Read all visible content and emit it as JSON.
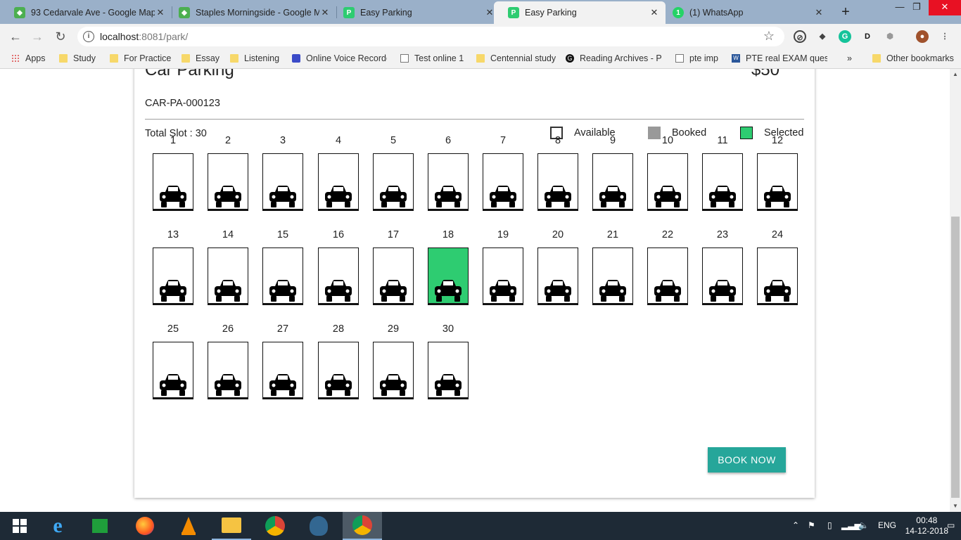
{
  "browser": {
    "tabs": [
      {
        "title": "93 Cedarvale Ave - Google Map",
        "icon": "google-maps-icon",
        "active": false
      },
      {
        "title": "Staples Morningside - Google M",
        "icon": "google-maps-icon",
        "active": false
      },
      {
        "title": "Easy Parking",
        "icon": "easy-parking-icon",
        "active": false
      },
      {
        "title": "Easy Parking",
        "icon": "easy-parking-icon",
        "active": true
      },
      {
        "title": "(1) WhatsApp",
        "icon": "whatsapp-icon",
        "active": false
      }
    ],
    "url_host": "localhost",
    "url_rest": ":8081/park/",
    "bookmarks": [
      {
        "label": "Apps",
        "icon": "apps-icon"
      },
      {
        "label": "Study",
        "icon": "folder-icon"
      },
      {
        "label": "For Practice",
        "icon": "folder-icon"
      },
      {
        "label": "Essay",
        "icon": "folder-icon"
      },
      {
        "label": "Listening",
        "icon": "folder-icon"
      },
      {
        "label": "Online Voice Recorde",
        "icon": "recorder-icon"
      },
      {
        "label": "Test online 1",
        "icon": "page-icon"
      },
      {
        "label": "Centennial study",
        "icon": "folder-icon"
      },
      {
        "label": "Reading Archives - P",
        "icon": "reading-icon"
      },
      {
        "label": "pte imp",
        "icon": "page-icon"
      },
      {
        "label": "PTE real EXAM quest",
        "icon": "word-doc-icon"
      }
    ],
    "bookmarks_overflow": "»",
    "other_bookmarks": "Other bookmarks"
  },
  "parking": {
    "title": "Car Parking",
    "price": "$50",
    "code": "CAR-PA-000123",
    "total_slots_label": "Total Slot : 30",
    "legend": {
      "available": "Available",
      "booked": "Booked",
      "selected": "Selected"
    },
    "colors": {
      "available": "#ffffff",
      "booked": "#999999",
      "selected": "#2ecc71",
      "button": "#26a69a"
    },
    "slots": [
      {
        "number": "1",
        "status": "available"
      },
      {
        "number": "2",
        "status": "available"
      },
      {
        "number": "3",
        "status": "available"
      },
      {
        "number": "4",
        "status": "available"
      },
      {
        "number": "5",
        "status": "available"
      },
      {
        "number": "6",
        "status": "available"
      },
      {
        "number": "7",
        "status": "available"
      },
      {
        "number": "8",
        "status": "available"
      },
      {
        "number": "9",
        "status": "available"
      },
      {
        "number": "10",
        "status": "available"
      },
      {
        "number": "11",
        "status": "available"
      },
      {
        "number": "12",
        "status": "available"
      },
      {
        "number": "13",
        "status": "available"
      },
      {
        "number": "14",
        "status": "available"
      },
      {
        "number": "15",
        "status": "available"
      },
      {
        "number": "16",
        "status": "available"
      },
      {
        "number": "17",
        "status": "available"
      },
      {
        "number": "18",
        "status": "selected"
      },
      {
        "number": "19",
        "status": "available"
      },
      {
        "number": "20",
        "status": "available"
      },
      {
        "number": "21",
        "status": "available"
      },
      {
        "number": "22",
        "status": "available"
      },
      {
        "number": "23",
        "status": "available"
      },
      {
        "number": "24",
        "status": "available"
      },
      {
        "number": "25",
        "status": "available"
      },
      {
        "number": "26",
        "status": "available"
      },
      {
        "number": "27",
        "status": "available"
      },
      {
        "number": "28",
        "status": "available"
      },
      {
        "number": "29",
        "status": "available"
      },
      {
        "number": "30",
        "status": "available"
      }
    ],
    "book_button": "BOOK NOW"
  },
  "taskbar": {
    "language": "ENG",
    "time": "00:48",
    "date": "14-12-2018"
  }
}
